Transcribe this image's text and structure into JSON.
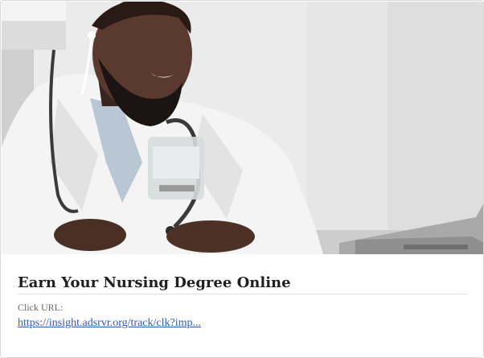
{
  "ad": {
    "image_subject": "smiling-doctor-with-laptop",
    "title": "Earn Your Nursing Degree Online",
    "click_url_label": "Click URL:",
    "click_url": "https://insight.adsrvr.org/track/clk?imp..."
  },
  "colors": {
    "title": "#1f1f1f",
    "label": "#666666",
    "link": "#2b5ea8",
    "card_border": "#d9d9d9"
  }
}
